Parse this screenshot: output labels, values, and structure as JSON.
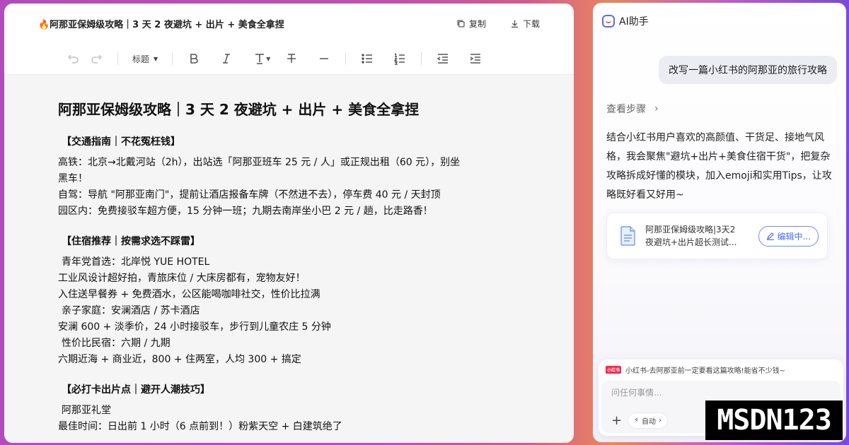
{
  "editor": {
    "title": "🔥阿那亚保姆级攻略｜3 天 2 夜避坑 + 出片 + 美食全拿捏",
    "copy_label": "复制",
    "download_label": "下载",
    "toolbar": {
      "heading_label": "标题",
      "items": [
        "undo-icon",
        "redo-icon",
        "bold-icon",
        "italic-icon",
        "text-color-icon",
        "strikethrough-icon",
        "divider-icon",
        "bullet-list-icon",
        "ordered-list-icon",
        "outdent-icon",
        "indent-icon"
      ]
    },
    "doc": {
      "h1": "阿那亚保姆级攻略｜3 天 2 夜避坑 + 出片 + 美食全拿捏",
      "sections": [
        {
          "title": "【交通指南｜不花冤枉钱】",
          "lines": [
            "高铁：北京→北戴河站（2h），出站选「阿那亚班车 25 元 / 人」或正规出租（60 元），别坐",
            "黑车！",
            "自驾：导航 \"阿那亚南门\"，提前让酒店报备车牌（不然进不去），停车费 40 元 / 天封顶",
            "园区内：免费接驳车超方便，15 分钟一班；九期去南岸坐小巴 2 元 / 趟，比走路香！"
          ]
        },
        {
          "title": "【住宿推荐｜按需求选不踩雷】",
          "lines": [
            " 青年党首选：北岸悦 YUE HOTEL",
            "工业风设计超好拍，青旅床位 / 大床房都有，宠物友好！",
            "入住送早餐券 + 免费酒水，公区能喝咖啡社交，性价比拉满",
            " 亲子家庭：安澜酒店 / 苏卡酒店",
            "安澜 600 + 淡季价，24 小时接驳车，步行到儿童农庄 5 分钟",
            " 性价比民宿：六期 / 九期",
            "六期近海 + 商业近，800 + 住两室，人均 300 + 搞定"
          ]
        },
        {
          "title": "【必打卡出片点｜避开人潮技巧】",
          "lines": [
            " 阿那亚礼堂",
            "最佳时间：日出前 1 小时（6 点前到！）粉紫天空 + 白建筑绝了"
          ]
        }
      ]
    }
  },
  "ai": {
    "title": "AI助手",
    "user_message": "改写一篇小红书的阿那亚的旅行攻略",
    "steps_label": "查看步骤",
    "answer": "结合小红书用户喜欢的高颜值、干货足、接地气风格，我会聚焦\"避坑+出片+美食住宿干货\"，把复杂攻略拆成好懂的模块，加入emoji和实用Tips，让攻略既好看又好用~",
    "file_card": {
      "name_line1": "阿那亚保姆级攻略|3天2",
      "name_line2": "夜避坑+出片超长测试...",
      "edit_label": "编辑中..."
    },
    "reference": {
      "badge": "小红书",
      "text": "小红书-去阿那亚前一定要看这篇攻略!能省不少钱~"
    },
    "input": {
      "placeholder": "问任何事情...",
      "auto_label": "自动"
    }
  },
  "watermark": "MSDN123"
}
